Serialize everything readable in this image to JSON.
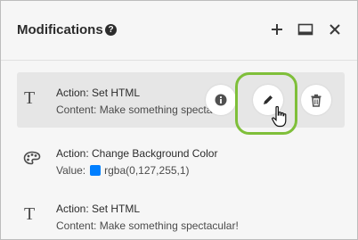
{
  "panel": {
    "title": "Modifications",
    "help_glyph": "?"
  },
  "header_actions": [
    {
      "name": "add-icon"
    },
    {
      "name": "layout-icon"
    },
    {
      "name": "close-icon"
    }
  ],
  "modifications": [
    {
      "type_icon": "text-type-icon",
      "glyph": "T",
      "action": "Action: Set HTML",
      "detail": "Content: Make something spectacular!",
      "hovered": true
    },
    {
      "type_icon": "palette-icon",
      "action": "Action: Change Background Color",
      "detail_label": "Value:",
      "detail_value": "rgba(0,127,255,1)",
      "swatch_color": "#007fff"
    },
    {
      "type_icon": "text-type-icon",
      "glyph": "T",
      "action": "Action: Set HTML",
      "detail": "Content: Make something spectacular!"
    }
  ],
  "row_actions": [
    {
      "name": "info-icon"
    },
    {
      "name": "pencil-icon"
    },
    {
      "name": "trash-icon"
    }
  ],
  "colors": {
    "highlight": "#7fbf3a",
    "hover_row": "#e6e6e6",
    "swatch": "#007fff"
  }
}
